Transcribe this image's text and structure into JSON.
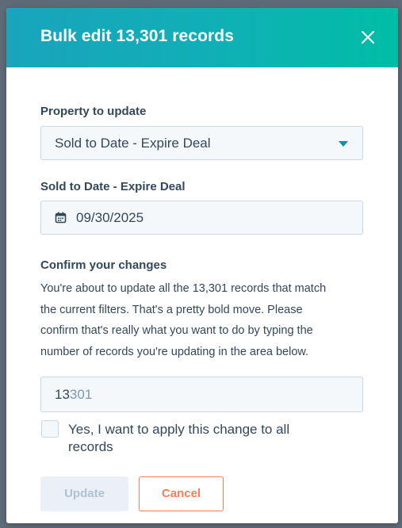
{
  "modal": {
    "title": "Bulk edit 13,301 records"
  },
  "property": {
    "label": "Property to update",
    "selected": "Sold to Date - Expire Deal"
  },
  "date_field": {
    "label": "Sold to Date - Expire Deal",
    "value": "09/30/2025"
  },
  "confirm": {
    "heading": "Confirm your changes",
    "description_lines": [
      "You're about to update all the 13,301 records that match",
      "the current filters. That's a pretty bold move. Please",
      "confirm that's really what you want to do by typing the",
      "number of records you're updating in the area below."
    ],
    "typed_value": "13",
    "placeholder_rest": "301",
    "checkbox_label_line1": "Yes, I want to apply this change to all",
    "checkbox_label_line2": "records",
    "checkbox_checked": false
  },
  "buttons": {
    "update_label": "Update",
    "cancel_label": "Cancel"
  },
  "colors": {
    "header_gradient_start": "#1aa4bd",
    "header_gradient_end": "#00bda5",
    "text": "#33475b",
    "caret": "#0091ae",
    "cancel": "#ff7a59",
    "disabled_bg": "#eaf0f6",
    "disabled_text": "#b0c1d4"
  },
  "icons": {
    "close": "close-icon",
    "calendar": "calendar-icon",
    "dropdown": "chevron-down-icon"
  }
}
